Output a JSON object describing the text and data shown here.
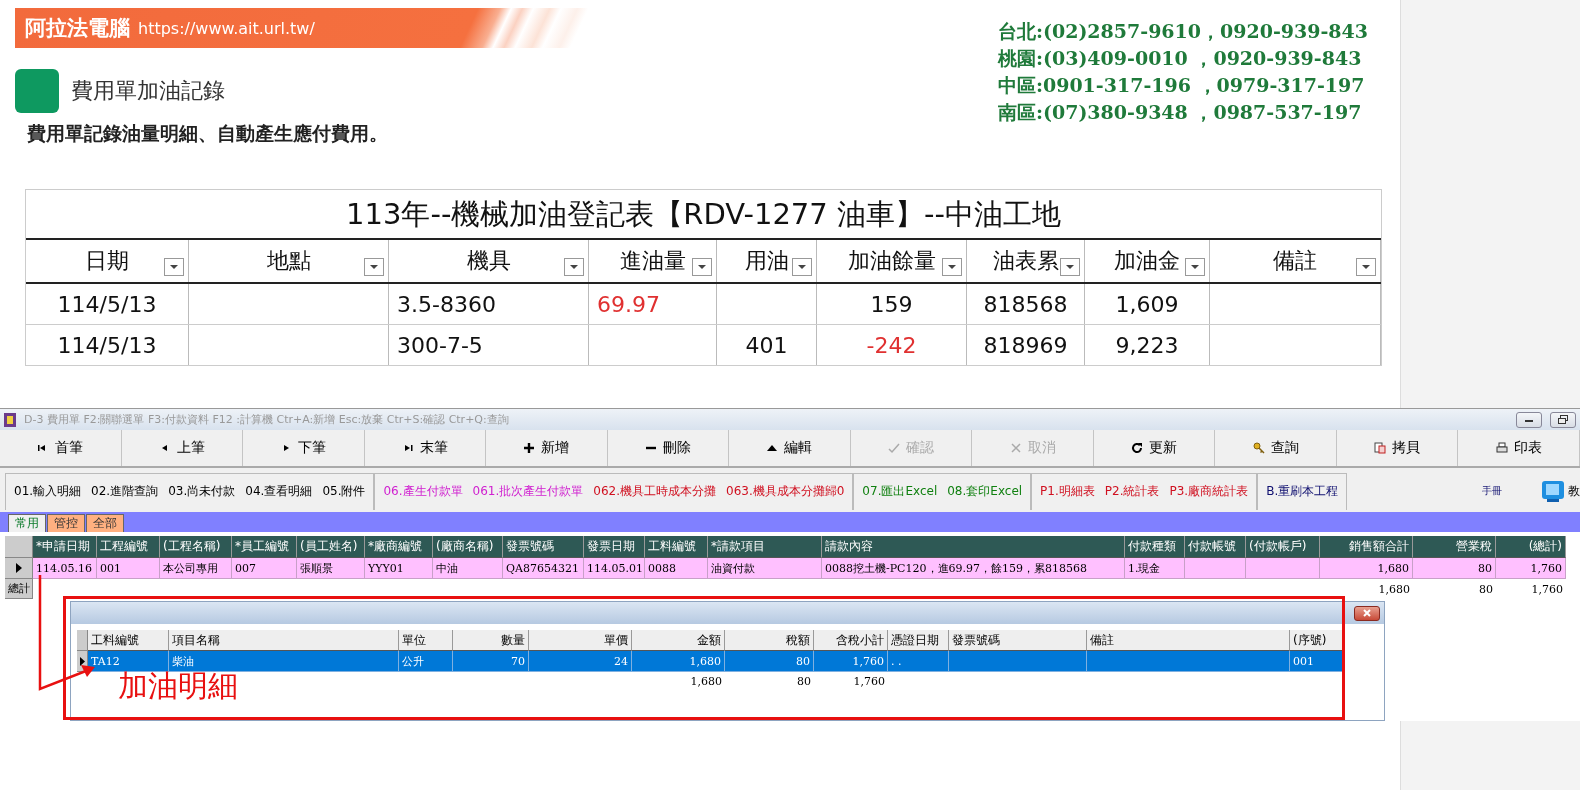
{
  "banner": {
    "brand": "阿拉法電腦",
    "url": "https://www.ait.url.tw/"
  },
  "contacts": [
    "台北:(02)2857-9610，0920-939-843",
    "桃園:(03)409-0010 ，0920-939-843",
    "中區:0901-317-196 ，0979-317-197",
    "南區:(07)380-9348 ，0987-537-197"
  ],
  "section": {
    "title": "費用單加油記錄",
    "subtitle": "費用單記錄油量明細、自動產生應付費用。"
  },
  "sheet": {
    "title": "113年--機械加油登記表【RDV-1277 油車】--中油工地",
    "columns": [
      "日期",
      "地點",
      "機具",
      "進油量",
      "用油",
      "加油餘量",
      "油表累",
      "加油金",
      "備註"
    ],
    "rows": [
      [
        {
          "text": "114/5/13"
        },
        {
          "text": ""
        },
        {
          "text": "3.5-8360"
        },
        {
          "text": "69.97",
          "color": "#e03030"
        },
        {
          "text": ""
        },
        {
          "text": "159"
        },
        {
          "text": "818568"
        },
        {
          "text": "1,609"
        },
        {
          "text": ""
        }
      ],
      [
        {
          "text": "114/5/13"
        },
        {
          "text": ""
        },
        {
          "text": "300-7-5"
        },
        {
          "text": ""
        },
        {
          "text": "401"
        },
        {
          "text": "-242",
          "color": "#e03030"
        },
        {
          "text": "818969"
        },
        {
          "text": "9,223"
        },
        {
          "text": ""
        }
      ]
    ]
  },
  "app": {
    "title": "D-3  費用單  F2:關聯選單  F3:付款資料  F12 :計算機  Ctr+A:新增  Esc:放棄  Ctr+S:確認  Ctr+Q:查詢",
    "toolbar": [
      {
        "kind": "first",
        "label": "首筆",
        "disabled": false
      },
      {
        "kind": "prev",
        "label": "上筆",
        "disabled": false
      },
      {
        "kind": "next",
        "label": "下筆",
        "disabled": false
      },
      {
        "kind": "last",
        "label": "末筆",
        "disabled": false
      },
      {
        "kind": "add",
        "label": "新增",
        "disabled": false
      },
      {
        "kind": "remove",
        "label": "刪除",
        "disabled": false
      },
      {
        "kind": "edit",
        "label": "編輯",
        "disabled": false
      },
      {
        "kind": "confirm",
        "label": "確認",
        "disabled": true
      },
      {
        "kind": "cancel",
        "label": "取消",
        "disabled": true
      },
      {
        "kind": "refresh",
        "label": "更新",
        "disabled": false
      },
      {
        "kind": "search",
        "label": "查詢",
        "disabled": false
      },
      {
        "kind": "copy",
        "label": "拷貝",
        "disabled": false
      },
      {
        "kind": "print",
        "label": "印表",
        "disabled": false
      }
    ],
    "function_groups": [
      [
        {
          "label": "01.輸入明細",
          "color": "#000000"
        },
        {
          "label": "02.進階查詢",
          "color": "#000000"
        },
        {
          "label": "03.尚未付款",
          "color": "#000000"
        },
        {
          "label": "04.查看明細",
          "color": "#000000"
        },
        {
          "label": "05.附件",
          "color": "#000000"
        }
      ],
      [
        {
          "label": "06.產生付款單",
          "color": "#d020d0"
        },
        {
          "label": "061.批次產生付款單",
          "color": "#d020d0"
        },
        {
          "label": "062.機具工時成本分攤",
          "color": "#d01020"
        },
        {
          "label": "063.機具成本分攤歸0",
          "color": "#d01020"
        }
      ],
      [
        {
          "label": "07.匯出Excel",
          "color": "#108010"
        },
        {
          "label": "08.套印Excel",
          "color": "#108010"
        }
      ],
      [
        {
          "label": "P1.明細表",
          "color": "#d01020"
        },
        {
          "label": "P2.統計表",
          "color": "#d01020"
        },
        {
          "label": "P3.廠商統計表",
          "color": "#d01020"
        }
      ],
      [
        {
          "label": "B.重刷本工程",
          "color": "#101070"
        }
      ]
    ],
    "manual": "手冊",
    "teach": "教",
    "tabs": [
      {
        "label": "常用",
        "selected": true
      },
      {
        "label": "管控",
        "selected": false
      },
      {
        "label": "全部",
        "selected": false
      }
    ],
    "grid": {
      "columns": [
        "*申請日期",
        "工程編號",
        "(工程名稱)",
        "*員工編號",
        "(員工姓名)",
        "*廠商編號",
        "(廠商名稱)",
        "發票號碼",
        "發票日期",
        "工料編號",
        "*請款項目",
        "請款內容",
        "付款種類",
        "付款帳號",
        "(付款帳戶)",
        "銷售額合計",
        "營業稅",
        "(總計)"
      ],
      "rows": [
        {
          "selected": true,
          "cells": [
            "114.05.16",
            "001",
            "本公司專用",
            "007",
            "張順景",
            "YYY01",
            "中油",
            "QA87654321",
            "114.05.01",
            "0088",
            "油資付款",
            "0088挖土機-PC120，進69.97，餘159，累818568",
            "1.現金",
            "",
            "",
            "1,680",
            "80",
            "1,760"
          ]
        }
      ],
      "total_label": "總計",
      "totals": [
        "1,680",
        "80",
        "1,760"
      ]
    },
    "detail": {
      "columns": [
        "工料編號",
        "項目名稱",
        "單位",
        "數量",
        "單價",
        "金額",
        "稅額",
        "含稅小計",
        "憑證日期",
        "發票號碼",
        "備註",
        "(序號)"
      ],
      "rows": [
        {
          "selected": true,
          "cells": [
            "TA12",
            "柴油",
            "公升",
            "70",
            "24",
            "1,680",
            "80",
            "1,760",
            ". .",
            "",
            "",
            "001"
          ]
        }
      ],
      "totals": [
        "1,680",
        "80",
        "1,760"
      ]
    },
    "annotation": "加油明細"
  }
}
